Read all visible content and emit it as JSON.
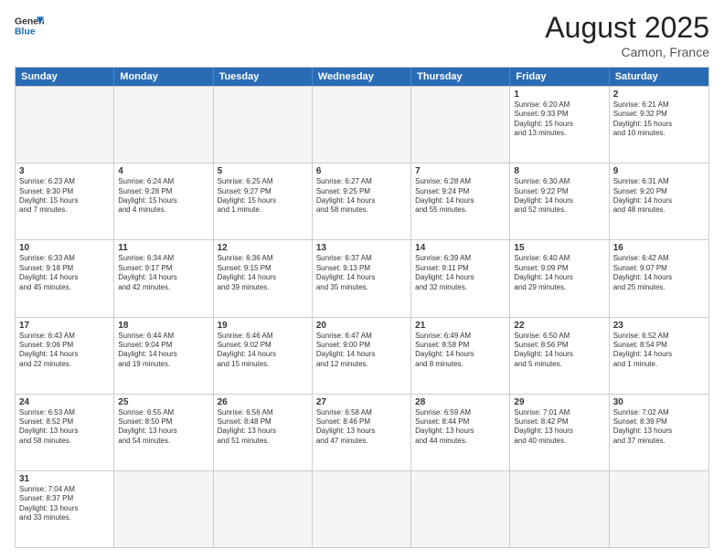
{
  "header": {
    "logo_general": "General",
    "logo_blue": "Blue",
    "month_year": "August 2025",
    "location": "Camon, France"
  },
  "days_of_week": [
    "Sunday",
    "Monday",
    "Tuesday",
    "Wednesday",
    "Thursday",
    "Friday",
    "Saturday"
  ],
  "weeks": [
    [
      {
        "day": "",
        "empty": true
      },
      {
        "day": "",
        "empty": true
      },
      {
        "day": "",
        "empty": true
      },
      {
        "day": "",
        "empty": true
      },
      {
        "day": "",
        "empty": true
      },
      {
        "day": "1",
        "text": "Sunrise: 6:20 AM\nSunset: 9:33 PM\nDaylight: 15 hours\nand 13 minutes."
      },
      {
        "day": "2",
        "text": "Sunrise: 6:21 AM\nSunset: 9:32 PM\nDaylight: 15 hours\nand 10 minutes."
      }
    ],
    [
      {
        "day": "3",
        "text": "Sunrise: 6:23 AM\nSunset: 9:30 PM\nDaylight: 15 hours\nand 7 minutes."
      },
      {
        "day": "4",
        "text": "Sunrise: 6:24 AM\nSunset: 9:28 PM\nDaylight: 15 hours\nand 4 minutes."
      },
      {
        "day": "5",
        "text": "Sunrise: 6:25 AM\nSunset: 9:27 PM\nDaylight: 15 hours\nand 1 minute."
      },
      {
        "day": "6",
        "text": "Sunrise: 6:27 AM\nSunset: 9:25 PM\nDaylight: 14 hours\nand 58 minutes."
      },
      {
        "day": "7",
        "text": "Sunrise: 6:28 AM\nSunset: 9:24 PM\nDaylight: 14 hours\nand 55 minutes."
      },
      {
        "day": "8",
        "text": "Sunrise: 6:30 AM\nSunset: 9:22 PM\nDaylight: 14 hours\nand 52 minutes."
      },
      {
        "day": "9",
        "text": "Sunrise: 6:31 AM\nSunset: 9:20 PM\nDaylight: 14 hours\nand 48 minutes."
      }
    ],
    [
      {
        "day": "10",
        "text": "Sunrise: 6:33 AM\nSunset: 9:18 PM\nDaylight: 14 hours\nand 45 minutes."
      },
      {
        "day": "11",
        "text": "Sunrise: 6:34 AM\nSunset: 9:17 PM\nDaylight: 14 hours\nand 42 minutes."
      },
      {
        "day": "12",
        "text": "Sunrise: 6:36 AM\nSunset: 9:15 PM\nDaylight: 14 hours\nand 39 minutes."
      },
      {
        "day": "13",
        "text": "Sunrise: 6:37 AM\nSunset: 9:13 PM\nDaylight: 14 hours\nand 35 minutes."
      },
      {
        "day": "14",
        "text": "Sunrise: 6:39 AM\nSunset: 9:11 PM\nDaylight: 14 hours\nand 32 minutes."
      },
      {
        "day": "15",
        "text": "Sunrise: 6:40 AM\nSunset: 9:09 PM\nDaylight: 14 hours\nand 29 minutes."
      },
      {
        "day": "16",
        "text": "Sunrise: 6:42 AM\nSunset: 9:07 PM\nDaylight: 14 hours\nand 25 minutes."
      }
    ],
    [
      {
        "day": "17",
        "text": "Sunrise: 6:43 AM\nSunset: 9:06 PM\nDaylight: 14 hours\nand 22 minutes."
      },
      {
        "day": "18",
        "text": "Sunrise: 6:44 AM\nSunset: 9:04 PM\nDaylight: 14 hours\nand 19 minutes."
      },
      {
        "day": "19",
        "text": "Sunrise: 6:46 AM\nSunset: 9:02 PM\nDaylight: 14 hours\nand 15 minutes."
      },
      {
        "day": "20",
        "text": "Sunrise: 6:47 AM\nSunset: 9:00 PM\nDaylight: 14 hours\nand 12 minutes."
      },
      {
        "day": "21",
        "text": "Sunrise: 6:49 AM\nSunset: 8:58 PM\nDaylight: 14 hours\nand 8 minutes."
      },
      {
        "day": "22",
        "text": "Sunrise: 6:50 AM\nSunset: 8:56 PM\nDaylight: 14 hours\nand 5 minutes."
      },
      {
        "day": "23",
        "text": "Sunrise: 6:52 AM\nSunset: 8:54 PM\nDaylight: 14 hours\nand 1 minute."
      }
    ],
    [
      {
        "day": "24",
        "text": "Sunrise: 6:53 AM\nSunset: 8:52 PM\nDaylight: 13 hours\nand 58 minutes."
      },
      {
        "day": "25",
        "text": "Sunrise: 6:55 AM\nSunset: 8:50 PM\nDaylight: 13 hours\nand 54 minutes."
      },
      {
        "day": "26",
        "text": "Sunrise: 6:56 AM\nSunset: 8:48 PM\nDaylight: 13 hours\nand 51 minutes."
      },
      {
        "day": "27",
        "text": "Sunrise: 6:58 AM\nSunset: 8:46 PM\nDaylight: 13 hours\nand 47 minutes."
      },
      {
        "day": "28",
        "text": "Sunrise: 6:59 AM\nSunset: 8:44 PM\nDaylight: 13 hours\nand 44 minutes."
      },
      {
        "day": "29",
        "text": "Sunrise: 7:01 AM\nSunset: 8:42 PM\nDaylight: 13 hours\nand 40 minutes."
      },
      {
        "day": "30",
        "text": "Sunrise: 7:02 AM\nSunset: 8:39 PM\nDaylight: 13 hours\nand 37 minutes."
      }
    ],
    [
      {
        "day": "31",
        "text": "Sunrise: 7:04 AM\nSunset: 8:37 PM\nDaylight: 13 hours\nand 33 minutes."
      },
      {
        "day": "",
        "empty": true
      },
      {
        "day": "",
        "empty": true
      },
      {
        "day": "",
        "empty": true
      },
      {
        "day": "",
        "empty": true
      },
      {
        "day": "",
        "empty": true
      },
      {
        "day": "",
        "empty": true
      }
    ]
  ]
}
